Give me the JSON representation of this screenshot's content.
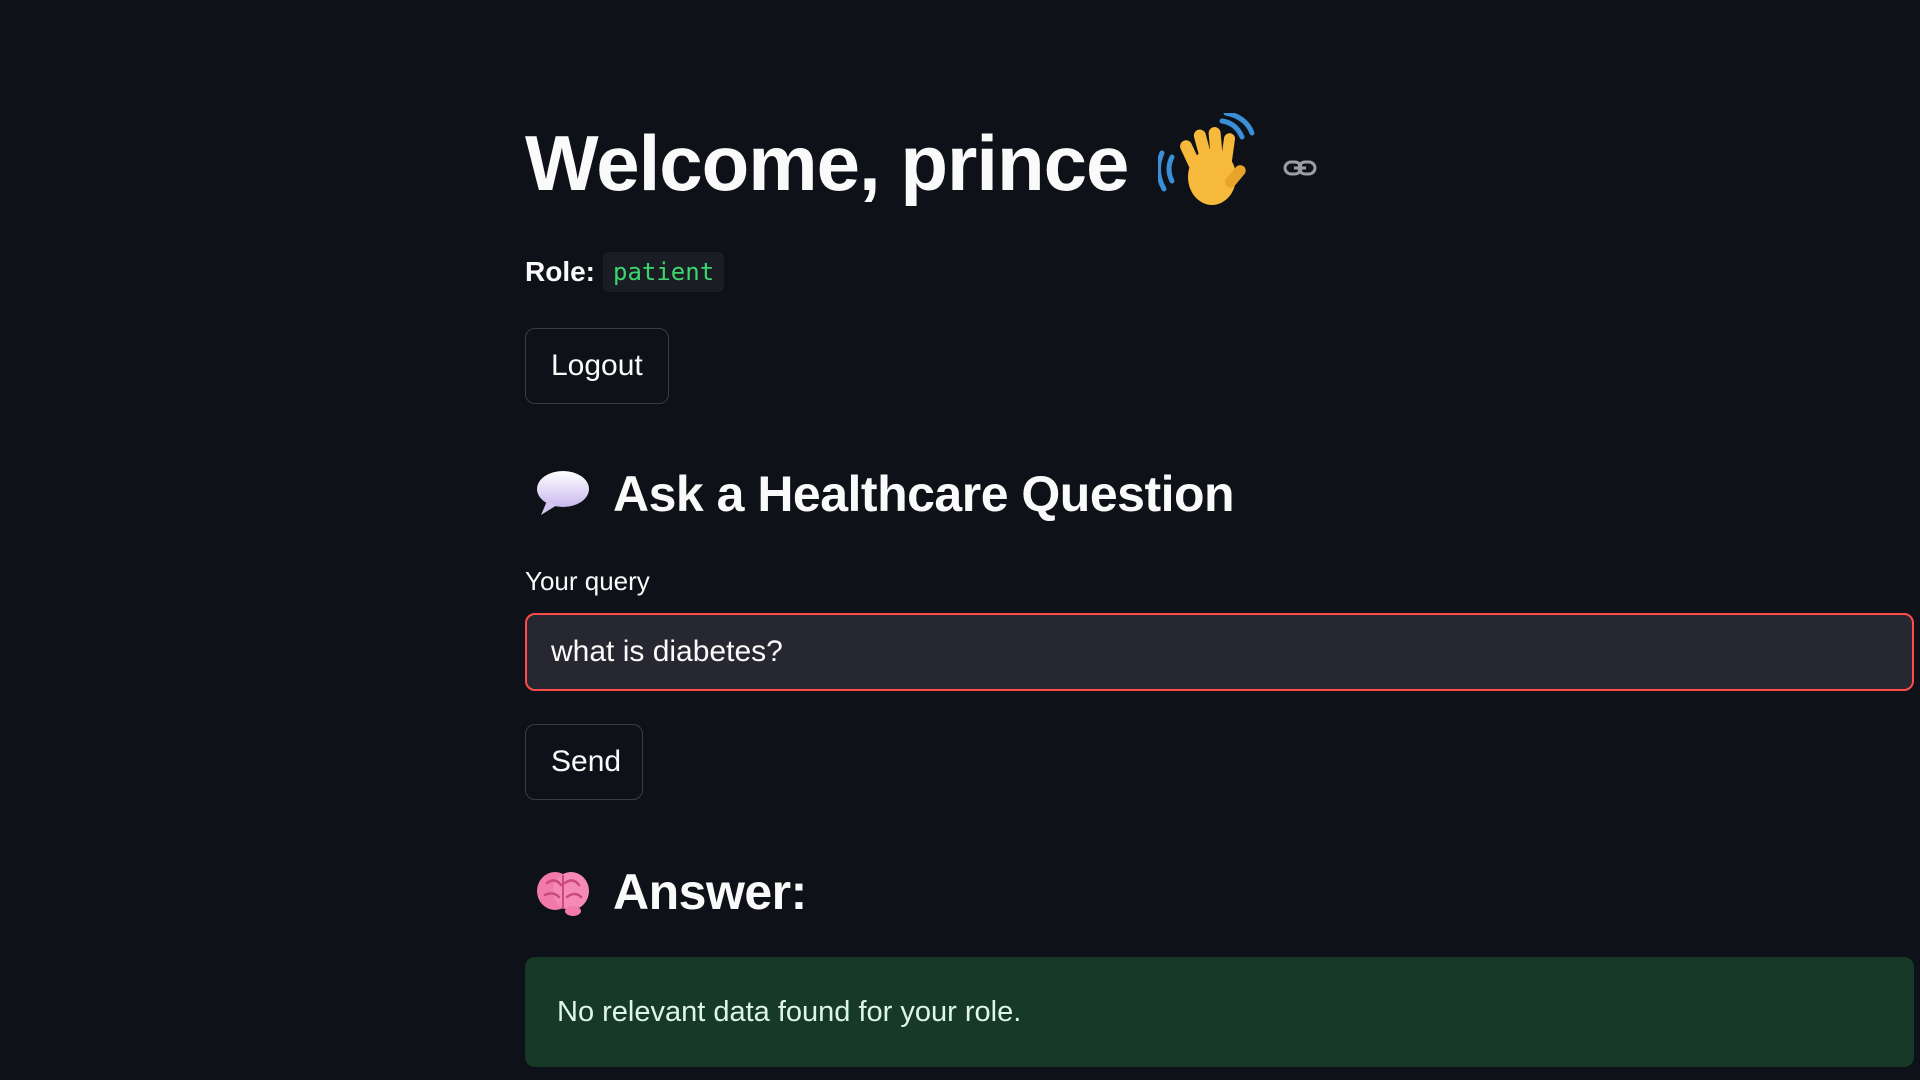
{
  "header": {
    "title": "Welcome, prince",
    "title_emoji_icon": "waving-hand-icon",
    "anchor_icon": "link-icon"
  },
  "role": {
    "label": "Role:",
    "value": "patient"
  },
  "logout": {
    "label": "Logout"
  },
  "ask_section": {
    "icon": "speech-bubble-icon",
    "heading": "Ask a Healthcare Question"
  },
  "query": {
    "label": "Your query",
    "value": "what is diabetes?"
  },
  "send": {
    "label": "Send"
  },
  "answer_section": {
    "icon": "brain-icon",
    "heading": "Answer:",
    "message": "No relevant data found for your role."
  },
  "colors": {
    "background": "#0e1117",
    "input_background": "#262730",
    "input_focus_border": "#ff4b4b",
    "code_text": "#3dd56d",
    "success_background": "#173928"
  }
}
